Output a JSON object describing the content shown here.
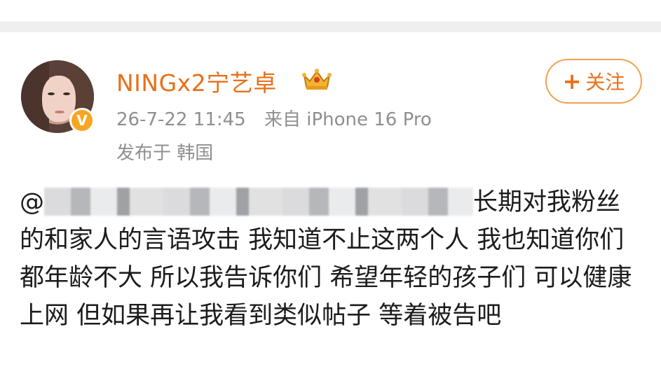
{
  "post": {
    "username": "NINGx2宁艺卓",
    "timestamp": "26-7-22 11:45",
    "source_prefix": "来自",
    "source_device": "iPhone 16 Pro",
    "location": "发布于 韩国",
    "follow_label": "关注",
    "follow_plus": "+",
    "verified_badge": "V",
    "mention_prefix": "@",
    "content_text": "长期对我粉丝的和家人的言语攻击 我知道不止这两个人 我也知道你们都年龄不大 所以我告诉你们 希望年轻的孩子们 可以健康上网 但如果再让我看到类似帖子 等着被告吧"
  },
  "icons": {
    "crown": "crown-icon",
    "verified": "verified-v-icon"
  },
  "colors": {
    "accent": "#e8701a",
    "meta": "#8f8f8f",
    "badge": "#f5a623"
  }
}
